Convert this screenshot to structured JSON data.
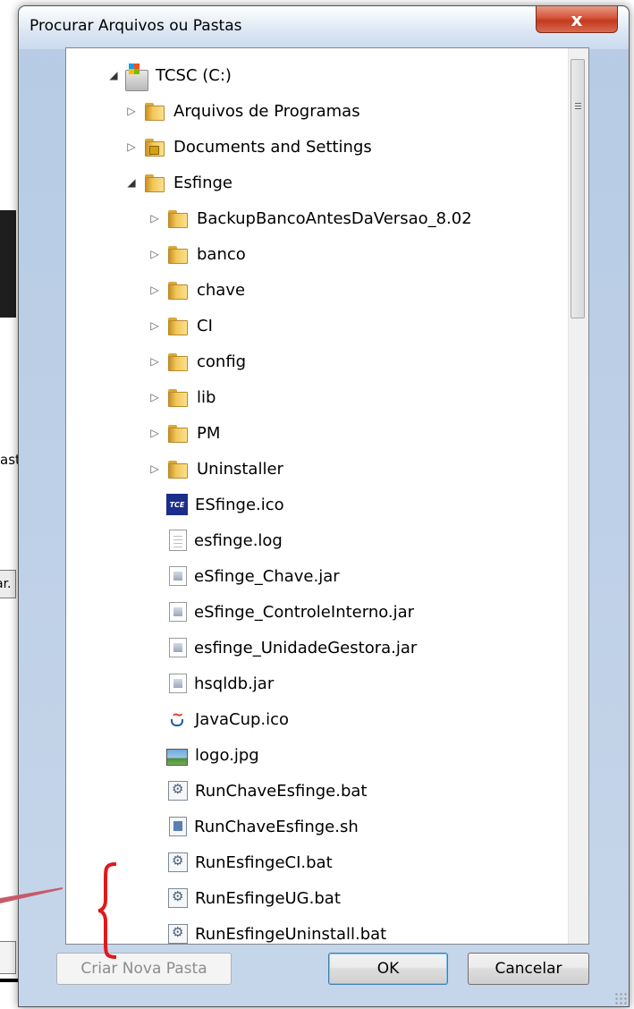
{
  "dialog": {
    "title": "Procurar Arquivos ou Pastas",
    "close_label": "x"
  },
  "background": {
    "partial_text": "ast",
    "partial_button": "ar."
  },
  "tree": {
    "root": {
      "label": "TCSC (C:)",
      "icon": "drive-icon",
      "expanded": true
    },
    "items": [
      {
        "label": "Arquivos de Programas",
        "icon": "folder-icon",
        "level": 1,
        "expander": "collapsed"
      },
      {
        "label": "Documents and Settings",
        "icon": "folder-lock-icon",
        "level": 1,
        "expander": "collapsed"
      },
      {
        "label": "Esfinge",
        "icon": "folder-icon",
        "level": 1,
        "expander": "expanded"
      },
      {
        "label": "BackupBancoAntesDaVersao_8.02",
        "icon": "folder-icon",
        "level": 2,
        "expander": "collapsed"
      },
      {
        "label": "banco",
        "icon": "folder-icon",
        "level": 2,
        "expander": "collapsed"
      },
      {
        "label": "chave",
        "icon": "folder-icon",
        "level": 2,
        "expander": "collapsed"
      },
      {
        "label": "CI",
        "icon": "folder-icon",
        "level": 2,
        "expander": "collapsed"
      },
      {
        "label": "config",
        "icon": "folder-icon",
        "level": 2,
        "expander": "collapsed"
      },
      {
        "label": "lib",
        "icon": "folder-icon",
        "level": 2,
        "expander": "collapsed"
      },
      {
        "label": "PM",
        "icon": "folder-icon",
        "level": 2,
        "expander": "collapsed"
      },
      {
        "label": "Uninstaller",
        "icon": "folder-icon",
        "level": 2,
        "expander": "collapsed"
      },
      {
        "label": "ESfinge.ico",
        "icon": "tce-ico-icon",
        "level": 2
      },
      {
        "label": "esfinge.log",
        "icon": "text-file-icon",
        "level": 2
      },
      {
        "label": "eSfinge_Chave.jar",
        "icon": "jar-file-icon",
        "level": 2
      },
      {
        "label": "eSfinge_ControleInterno.jar",
        "icon": "jar-file-icon",
        "level": 2
      },
      {
        "label": "esfinge_UnidadeGestora.jar",
        "icon": "jar-file-icon",
        "level": 2
      },
      {
        "label": "hsqldb.jar",
        "icon": "jar-file-icon",
        "level": 2
      },
      {
        "label": "JavaCup.ico",
        "icon": "java-icon",
        "level": 2
      },
      {
        "label": "logo.jpg",
        "icon": "image-file-icon",
        "level": 2
      },
      {
        "label": "RunChaveEsfinge.bat",
        "icon": "batch-file-icon",
        "level": 2
      },
      {
        "label": "RunChaveEsfinge.sh",
        "icon": "script-file-icon",
        "level": 2
      },
      {
        "label": "RunEsfingeCI.bat",
        "icon": "batch-file-icon",
        "level": 2
      },
      {
        "label": "RunEsfingeUG.bat",
        "icon": "batch-file-icon",
        "level": 2
      },
      {
        "label": "RunEsfingeUninstall.bat",
        "icon": "batch-file-icon",
        "level": 2
      }
    ]
  },
  "buttons": {
    "new_folder": "Criar Nova Pasta",
    "ok": "OK",
    "cancel": "Cancelar"
  },
  "annotation": {
    "color": "#e0191b",
    "arrow_color": "#c75a6a"
  }
}
